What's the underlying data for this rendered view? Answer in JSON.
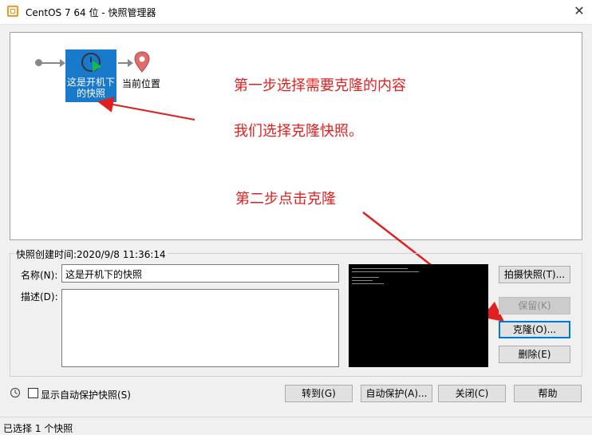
{
  "window": {
    "title": "CentOS 7 64 位 - 快照管理器",
    "close_glyph": "✕"
  },
  "tree": {
    "snapshot_label_line1": "这是开机下",
    "snapshot_label_line2": "的快照",
    "current_location_label": "当前位置"
  },
  "annotations": {
    "step1": "第一步选择需要克隆的内容",
    "step1_sub": "我们选择克隆快照。",
    "step2": "第二步点击克隆",
    "color": "#e02020"
  },
  "details": {
    "created_label": "快照创建时间:2020/9/8 11:36:14",
    "name_label": "名称(N):",
    "name_value": "这是开机下的快照",
    "desc_label": "描述(D):",
    "desc_value": ""
  },
  "buttons": {
    "take_snapshot": "拍摄快照(T)...",
    "keep": "保留(K)",
    "clone": "克隆(O)...",
    "delete": "删除(E)",
    "goto": "转到(G)",
    "autoprotect": "自动保护(A)...",
    "close": "关闭(C)",
    "help": "帮助"
  },
  "footer": {
    "show_autoprotect_label": "显示自动保护快照(S)",
    "show_autoprotect_checked": false
  },
  "status": {
    "text": "已选择 1 个快照"
  },
  "colors": {
    "selection": "#1979ca",
    "location_pin": "#e06b6b"
  }
}
